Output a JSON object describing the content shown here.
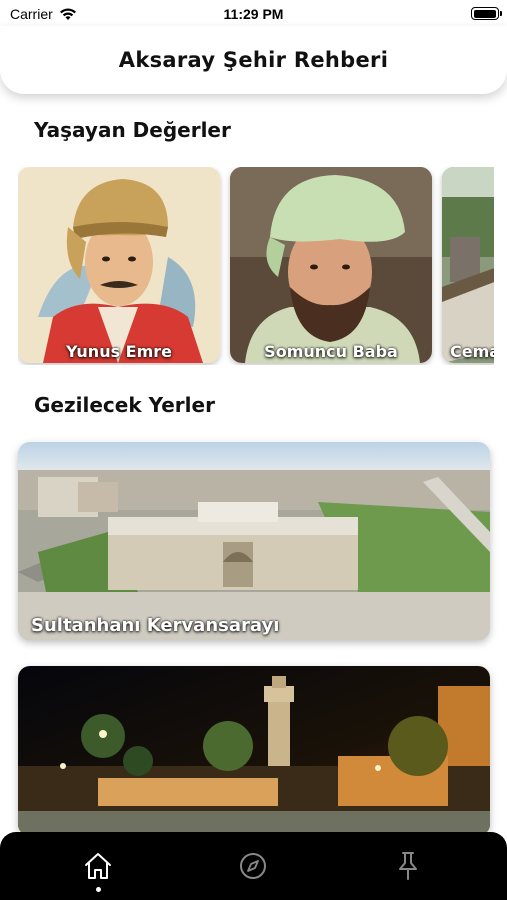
{
  "status_bar": {
    "carrier": "Carrier",
    "time": "11:29 PM",
    "battery_level": 0.9
  },
  "header": {
    "title": "Aksaray Şehir Rehberi"
  },
  "sections": {
    "living_values": {
      "title": "Yaşayan Değerler",
      "cards": [
        {
          "label": "Yunus Emre"
        },
        {
          "label": "Somuncu Baba"
        },
        {
          "label": "Cemal"
        }
      ]
    },
    "places": {
      "title": "Gezilecek Yerler",
      "cards": [
        {
          "label": "Sultanhanı Kervansarayı"
        },
        {
          "label": ""
        }
      ]
    }
  },
  "tab_bar": {
    "tabs": [
      {
        "icon": "home-icon",
        "active": true
      },
      {
        "icon": "compass-icon",
        "active": false
      },
      {
        "icon": "pin-icon",
        "active": false
      }
    ]
  }
}
